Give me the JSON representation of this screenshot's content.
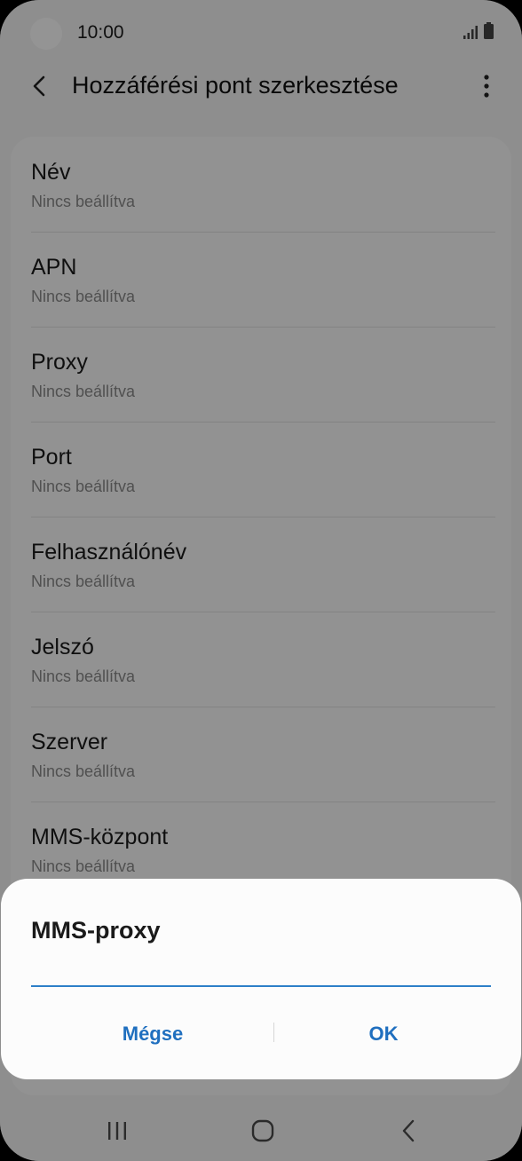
{
  "status_bar": {
    "time": "10:00"
  },
  "app_bar": {
    "title": "Hozzáférési pont szerkesztése"
  },
  "settings": [
    {
      "label": "Név",
      "value": "Nincs beállítva"
    },
    {
      "label": "APN",
      "value": "Nincs beállítva"
    },
    {
      "label": "Proxy",
      "value": "Nincs beállítva"
    },
    {
      "label": "Port",
      "value": "Nincs beállítva"
    },
    {
      "label": "Felhasználónév",
      "value": "Nincs beállítva"
    },
    {
      "label": "Jelszó",
      "value": "Nincs beállítva"
    },
    {
      "label": "Szerver",
      "value": "Nincs beállítva"
    },
    {
      "label": "MMS-központ",
      "value": "Nincs beállítva"
    }
  ],
  "dialog": {
    "title": "MMS-proxy",
    "input_value": "",
    "cancel_label": "Mégse",
    "ok_label": "OK"
  },
  "colors": {
    "accent": "#1f6fbf",
    "input_underline": "#2d7fc8"
  },
  "icons": [
    "back-arrow-icon",
    "more-options-icon",
    "signal-icon",
    "battery-icon",
    "recent-apps-icon",
    "home-icon",
    "nav-back-icon"
  ]
}
